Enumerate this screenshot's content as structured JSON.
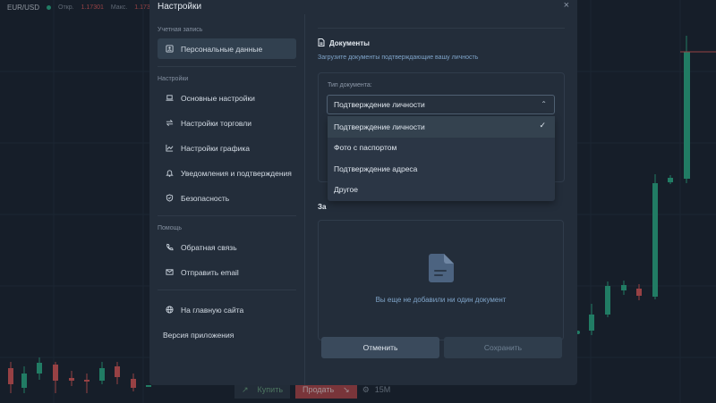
{
  "ticker": {
    "pair": "EUR/USD",
    "open_label": "Откр.",
    "open_value": "1.17301",
    "max_label": "Макс.",
    "max_value": "1.173"
  },
  "bottom_bar": {
    "buy": "Купить",
    "sell": "Продать",
    "timeframe": "15M"
  },
  "modal": {
    "title": "Настройки",
    "close": "×"
  },
  "sidebar": {
    "account_title": "Учетная запись",
    "settings_title": "Настройки",
    "help_title": "Помощь",
    "items": [
      {
        "label": "Персональные данные",
        "icon": "user-card-icon"
      },
      {
        "label": "Основные настройки",
        "icon": "laptop-icon"
      },
      {
        "label": "Настройки торговли",
        "icon": "swap-icon"
      },
      {
        "label": "Настройки графика",
        "icon": "chart-icon"
      },
      {
        "label": "Уведомления и подтверждения",
        "icon": "bell-icon"
      },
      {
        "label": "Безопасность",
        "icon": "shield-icon"
      },
      {
        "label": "Обратная связь",
        "icon": "phone-icon"
      },
      {
        "label": "Отправить email",
        "icon": "mail-icon"
      },
      {
        "label": "На главную сайта",
        "icon": "globe-icon"
      }
    ],
    "version_label": "Версия приложения"
  },
  "main": {
    "section_title": "Документы",
    "section_desc": "Загрузите документы подтверждающие вашу личность",
    "doc_type_label": "Тип документа:",
    "doc_type_value": "Подтверждение личности",
    "dropdown_options": [
      "Подтверждение личности",
      "Фото с паспортом",
      "Подтверждение адреса",
      "Другое"
    ],
    "uploads_partial": "За",
    "empty_text": "Вы еще не добавили ни один документ",
    "cancel": "Отменить",
    "save": "Сохранить"
  },
  "colors": {
    "up": "#2bb48a",
    "down": "#e05a5a",
    "bg": "#1b2430",
    "panel": "#232d3a"
  }
}
